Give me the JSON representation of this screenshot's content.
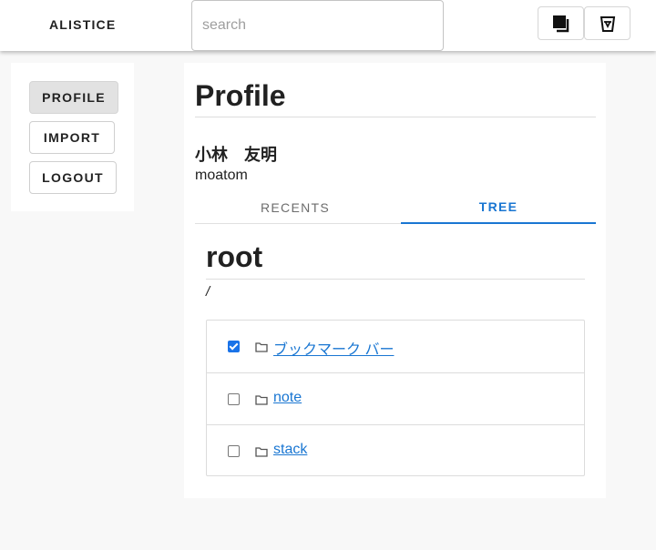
{
  "header": {
    "brand": "ALISTICE",
    "search_placeholder": "search",
    "icons": [
      "copy-icon",
      "trash-icon"
    ]
  },
  "sidebar": {
    "items": [
      {
        "label": "PROFILE",
        "active": true
      },
      {
        "label": "IMPORT",
        "active": false
      },
      {
        "label": "LOGOUT",
        "active": false
      }
    ]
  },
  "main": {
    "title": "Profile",
    "user_name": "小林　友明",
    "user_id": "moatom",
    "tabs": [
      {
        "label": "RECENTS",
        "active": false
      },
      {
        "label": "TREE",
        "active": true
      }
    ],
    "tree": {
      "title": "root",
      "path": "/",
      "items": [
        {
          "name": " ブックマーク バー",
          "checked": true,
          "icon": "folder-icon"
        },
        {
          "name": " note",
          "checked": false,
          "icon": "folder-icon"
        },
        {
          "name": " stack",
          "checked": false,
          "icon": "folder-icon"
        }
      ]
    }
  },
  "colors": {
    "accent": "#1976d2",
    "checkbox": "#1a73e8",
    "background": "#f8f8f8"
  }
}
